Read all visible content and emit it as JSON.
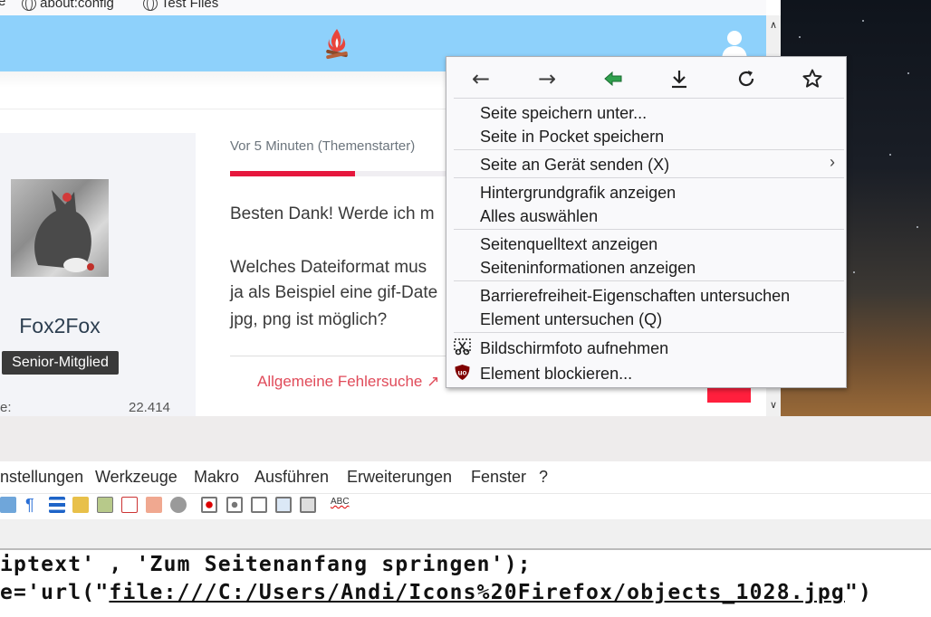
{
  "browser": {
    "bookmarks": [
      "e",
      "about:config",
      "Test Files"
    ],
    "post": {
      "meta": "Vor 5 Minuten (Themenstarter)",
      "read_progress": 0.53,
      "line1": "Besten Dank! Werde ich m",
      "line2": "Welches Dateiformat mus",
      "line3": "ja als Beispiel eine gif-Date",
      "line4": "jpg, png ist möglich?",
      "link": "Allgemeine Fehlersuche"
    },
    "author": {
      "name": "Fox2Fox",
      "role": "Senior-Mitglied",
      "stat_label": "e:",
      "stat_value": "22.414"
    }
  },
  "context_menu": {
    "nav_buttons": [
      "back-icon",
      "forward-icon",
      "back-alt-icon",
      "download-icon",
      "reload-icon",
      "bookmark-star-icon"
    ],
    "groups": [
      [
        "Seite speichern unter...",
        "Seite in Pocket speichern"
      ],
      [
        "Seite an Gerät senden (X)"
      ],
      [
        "Hintergrundgrafik anzeigen",
        "Alles auswählen"
      ],
      [
        "Seitenquelltext anzeigen",
        "Seiteninformationen anzeigen"
      ],
      [
        "Barrierefreiheit-Eigenschaften untersuchen",
        "Element untersuchen (Q)"
      ],
      [
        "Bildschirmfoto aufnehmen",
        "Element blockieren..."
      ]
    ],
    "accent": "#30a14e"
  },
  "editor": {
    "menu": [
      "nstellungen",
      "Werkzeuge",
      "Makro",
      "Ausführen",
      "Erweiterungen",
      "Fenster",
      "?"
    ],
    "code_line1": "iptext' , 'Zum Seitenanfang springen');",
    "code_line2_prefix": "e='url(\"",
    "code_line2_link": "file:///C:/Users/Andi/Icons%20Firefox/objects_1028.jpg",
    "code_line2_suffix": "\")"
  }
}
